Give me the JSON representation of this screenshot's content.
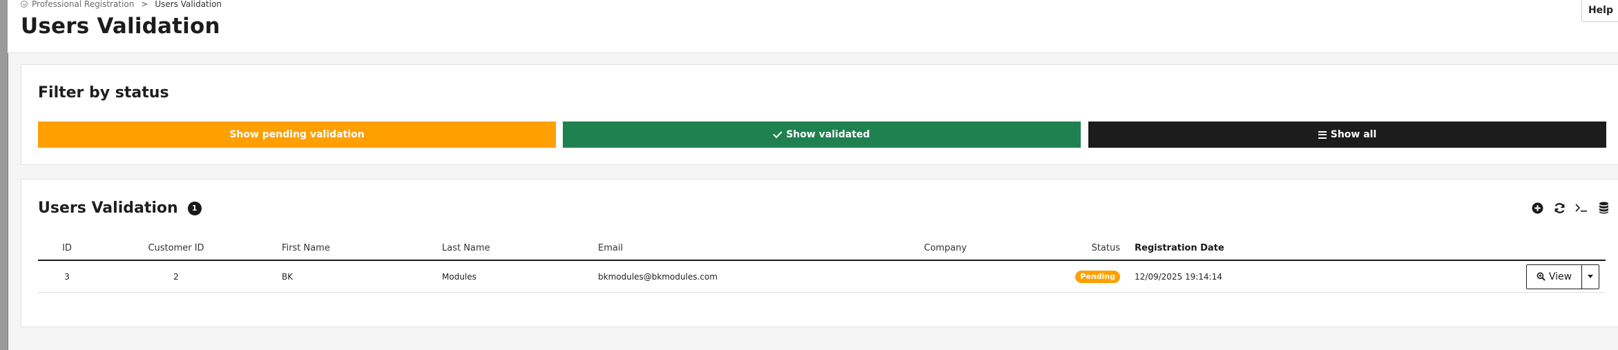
{
  "breadcrumb": {
    "parent": "Professional Registration",
    "separator": ">",
    "current": "Users Validation"
  },
  "header": {
    "title": "Users Validation",
    "help_label": "Help"
  },
  "filter_panel": {
    "title": "Filter by status",
    "buttons": {
      "pending": {
        "label": "Show pending validation",
        "color": "#ffa000"
      },
      "validated": {
        "label": "Show validated",
        "icon": "check-icon",
        "color": "#208150"
      },
      "all": {
        "label": "Show all",
        "icon": "list-icon",
        "color": "#1c1c1c"
      }
    }
  },
  "users_panel": {
    "title": "Users Validation",
    "count": "1",
    "toolbar": [
      "add-icon",
      "refresh-icon",
      "terminal-icon",
      "database-icon"
    ],
    "columns": {
      "id": "ID",
      "customer_id": "Customer ID",
      "first_name": "First Name",
      "last_name": "Last Name",
      "email": "Email",
      "company": "Company",
      "status": "Status",
      "registration_date": "Registration Date"
    },
    "rows": [
      {
        "id": "3",
        "customer_id": "2",
        "first_name": "BK",
        "last_name": "Modules",
        "email": "bkmodules@bkmodules.com",
        "company": "",
        "status": "Pending",
        "status_color": "#ffa000",
        "registration_date": "12/09/2025 19:14:14",
        "view_label": "View"
      }
    ]
  }
}
